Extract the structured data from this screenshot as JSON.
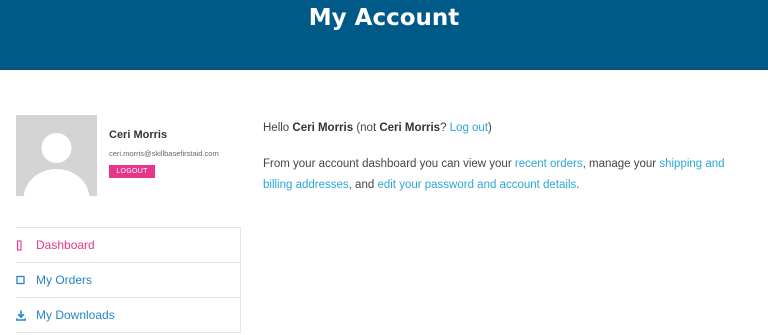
{
  "header": {
    "title": "My Account"
  },
  "profile": {
    "name": "Ceri Morris",
    "email": "ceri.morris@skillbasefirstaid.com",
    "logout_label": "LOGOUT"
  },
  "nav": {
    "items": [
      {
        "label": "Dashboard",
        "icon": "square-outline-icon"
      },
      {
        "label": "My Orders",
        "icon": "checkbox-icon"
      },
      {
        "label": "My Downloads",
        "icon": "download-icon"
      }
    ]
  },
  "content": {
    "hello_prefix": "Hello ",
    "user_name": "Ceri Morris",
    "not_prefix": " (not ",
    "not_name": "Ceri Morris",
    "question": "? ",
    "logout_link": "Log out",
    "close_paren": ")",
    "desc_part1": "From your account dashboard you can view your ",
    "recent_orders_link": "recent orders",
    "desc_part2": ", manage your ",
    "addresses_link": "shipping and billing addresses",
    "desc_part3": ", and ",
    "account_details_link": "edit your password and account details",
    "desc_part4": "."
  },
  "colors": {
    "header_bg": "#005a87",
    "accent_pink": "#e6368a",
    "link_blue": "#2aa7d6"
  }
}
